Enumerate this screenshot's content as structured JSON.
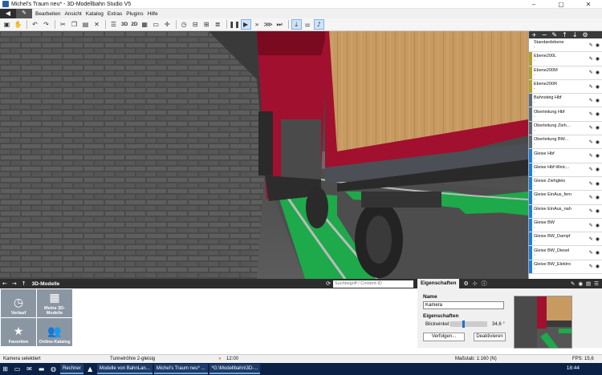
{
  "window": {
    "title": "Michel's Traum neu* - 3D-Modellbahn Studio V5",
    "controls": [
      "–",
      "▢",
      "✕"
    ]
  },
  "menu": {
    "items": [
      "Bearbeiten",
      "Ansicht",
      "Katalog",
      "Extras",
      "Plugins",
      "Hilfe"
    ]
  },
  "toolbar": {
    "label_3d": "3D",
    "label_2d": "2D"
  },
  "layers": {
    "items": [
      {
        "name": "Standardebene",
        "sub": "-",
        "color": "#ffffff"
      },
      {
        "name": "Ebene200L",
        "sub": "-",
        "color": "#b5a02a"
      },
      {
        "name": "Ebene200M",
        "sub": "-",
        "color": "#b5a02a"
      },
      {
        "name": "Ebene200R",
        "sub": "-",
        "color": "#b5a02a"
      },
      {
        "name": "Bahnsteig Hbf",
        "sub": "-",
        "color": "#5a6b78"
      },
      {
        "name": "Oberleitung Hbf",
        "sub": "-",
        "color": "#5a6b78"
      },
      {
        "name": "Oberleitung Zieh...",
        "sub": "-",
        "color": "#5a6b78"
      },
      {
        "name": "Oberleitung BW...",
        "sub": "-",
        "color": "#5a6b78"
      },
      {
        "name": "Gleise Hbf",
        "sub": "-",
        "color": "#1f7fd6"
      },
      {
        "name": "Gleise Hbf-Weic...",
        "sub": "-",
        "color": "#1f7fd6"
      },
      {
        "name": "Gleise Ziehgleis",
        "sub": "-",
        "color": "#1f7fd6"
      },
      {
        "name": "Gleise EinAus_fern",
        "sub": "-",
        "color": "#1f7fd6"
      },
      {
        "name": "Gleise EinAus_nah",
        "sub": "-",
        "color": "#1f7fd6"
      },
      {
        "name": "Gleise BW",
        "sub": "-",
        "color": "#1f7fd6"
      },
      {
        "name": "Gleise BW_Dampf",
        "sub": "-",
        "color": "#1f7fd6"
      },
      {
        "name": "Gleise BW_Diesel",
        "sub": "-",
        "color": "#1f7fd6"
      },
      {
        "name": "Gleise BW_Elektro",
        "sub": "-",
        "color": "#1f7fd6"
      }
    ]
  },
  "catalog": {
    "title": "3D-Modelle",
    "search_placeholder": "Suchbegriff / Content-ID",
    "tiles": [
      {
        "label": "Verlauf",
        "icon": "clock-icon"
      },
      {
        "label": "Meine 3D-Modelle",
        "icon": "grid-icon"
      },
      {
        "label": "Favoriten",
        "icon": "star-icon"
      },
      {
        "label": "Online-Katalog",
        "icon": "people-icon"
      }
    ]
  },
  "properties": {
    "tab": "Eigenschaften",
    "name_heading": "Name",
    "name_value": "Kamera",
    "props_heading": "Eigenschaften",
    "angle_label": "Blickwinkel:",
    "angle_value": "34,6 °",
    "follow_button": "Verfolgen...",
    "deactivate_button": "Deaktivieren"
  },
  "status": {
    "selection": "Kamera selektiert",
    "object": "Tunnelröhre 2-gleisig",
    "time": "12:00",
    "scale": "Maßstab: 1:160 (N)",
    "fps": "FPS: 15,6"
  },
  "taskbar": {
    "tasks": [
      "Rechner",
      "Modelle von BahnLan...",
      "Michel's Traum neu* ...",
      "*G:\\Modellbahn\\3D-..."
    ],
    "clock": "18:44"
  }
}
